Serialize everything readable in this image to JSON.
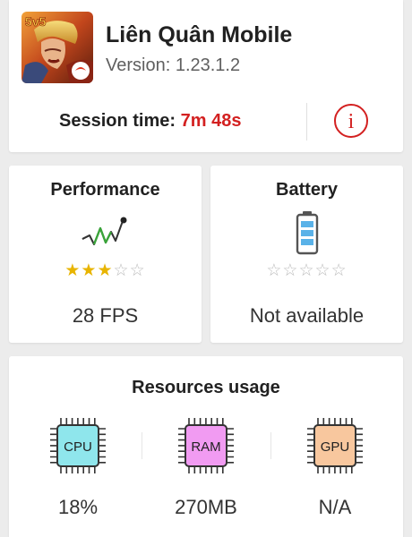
{
  "app": {
    "name": "Liên Quân Mobile",
    "version_label": "Version:",
    "version": "1.23.1.2",
    "icon_badge": "5v5",
    "icon_name": "game-app-icon"
  },
  "session": {
    "label": "Session time:",
    "value": "7m 48s",
    "value_color": "#d32020"
  },
  "info_button": {
    "icon": "info-icon",
    "glyph": "i",
    "color": "#d32020"
  },
  "performance": {
    "title": "Performance",
    "icon": "performance-graph-icon",
    "rating": 3,
    "rating_max": 5,
    "value": "28 FPS"
  },
  "battery": {
    "title": "Battery",
    "icon": "battery-icon",
    "rating": 0,
    "rating_max": 5,
    "value": "Not available"
  },
  "resources": {
    "title": "Resources usage",
    "items": [
      {
        "label": "CPU",
        "value": "18%",
        "color": "#8fe6ec",
        "icon": "cpu-chip-icon"
      },
      {
        "label": "RAM",
        "value": "270MB",
        "color": "#f19bf2",
        "icon": "ram-chip-icon"
      },
      {
        "label": "GPU",
        "value": "N/A",
        "color": "#f8c79e",
        "icon": "gpu-chip-icon"
      }
    ]
  }
}
